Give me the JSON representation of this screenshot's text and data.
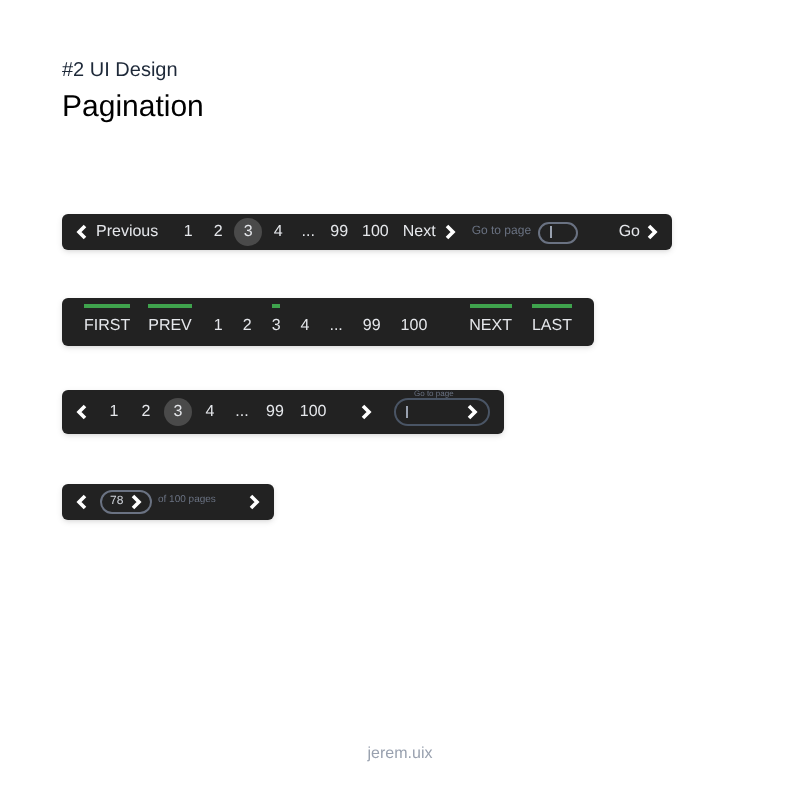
{
  "header": {
    "subtitle": "#2 UI Design",
    "title": "Pagination"
  },
  "paginators": [
    {
      "kind": "classic",
      "prev": "Previous",
      "next": "Next",
      "pages": [
        {
          "label": "1",
          "selected": false
        },
        {
          "label": "2",
          "selected": false
        },
        {
          "label": "3",
          "selected": true
        },
        {
          "label": "4",
          "selected": false
        },
        {
          "label": "...",
          "selected": false
        },
        {
          "label": "99",
          "selected": false
        },
        {
          "label": "100",
          "selected": false
        }
      ],
      "goto": {
        "label": "Go to page",
        "button": "Go"
      }
    },
    {
      "kind": "bars",
      "items": [
        {
          "kind": "nav",
          "label": "FIRST",
          "selected": true
        },
        {
          "kind": "nav",
          "label": "PREV",
          "selected": true
        },
        {
          "kind": "page",
          "label": "1",
          "selected": false
        },
        {
          "kind": "page",
          "label": "2",
          "selected": false
        },
        {
          "kind": "page",
          "label": "3",
          "selected": true
        },
        {
          "kind": "page",
          "label": "4",
          "selected": false
        },
        {
          "kind": "page",
          "label": "...",
          "selected": false
        },
        {
          "kind": "page",
          "label": "99",
          "selected": false
        },
        {
          "kind": "page",
          "label": "100",
          "selected": false
        },
        {
          "kind": "nav",
          "label": "NEXT",
          "selected": true
        },
        {
          "kind": "nav",
          "label": "LAST",
          "selected": true
        }
      ]
    },
    {
      "kind": "compact",
      "pages": [
        {
          "label": "1",
          "selected": false
        },
        {
          "label": "2",
          "selected": false
        },
        {
          "label": "3",
          "selected": true
        },
        {
          "label": "4",
          "selected": false
        },
        {
          "label": "...",
          "selected": false
        },
        {
          "label": "99",
          "selected": false
        },
        {
          "label": "100",
          "selected": false
        }
      ],
      "goto": {
        "label": "Go to page"
      }
    },
    {
      "kind": "mini",
      "value": "78",
      "total": "of 100 pages"
    }
  ],
  "footer": "jerem.uix"
}
